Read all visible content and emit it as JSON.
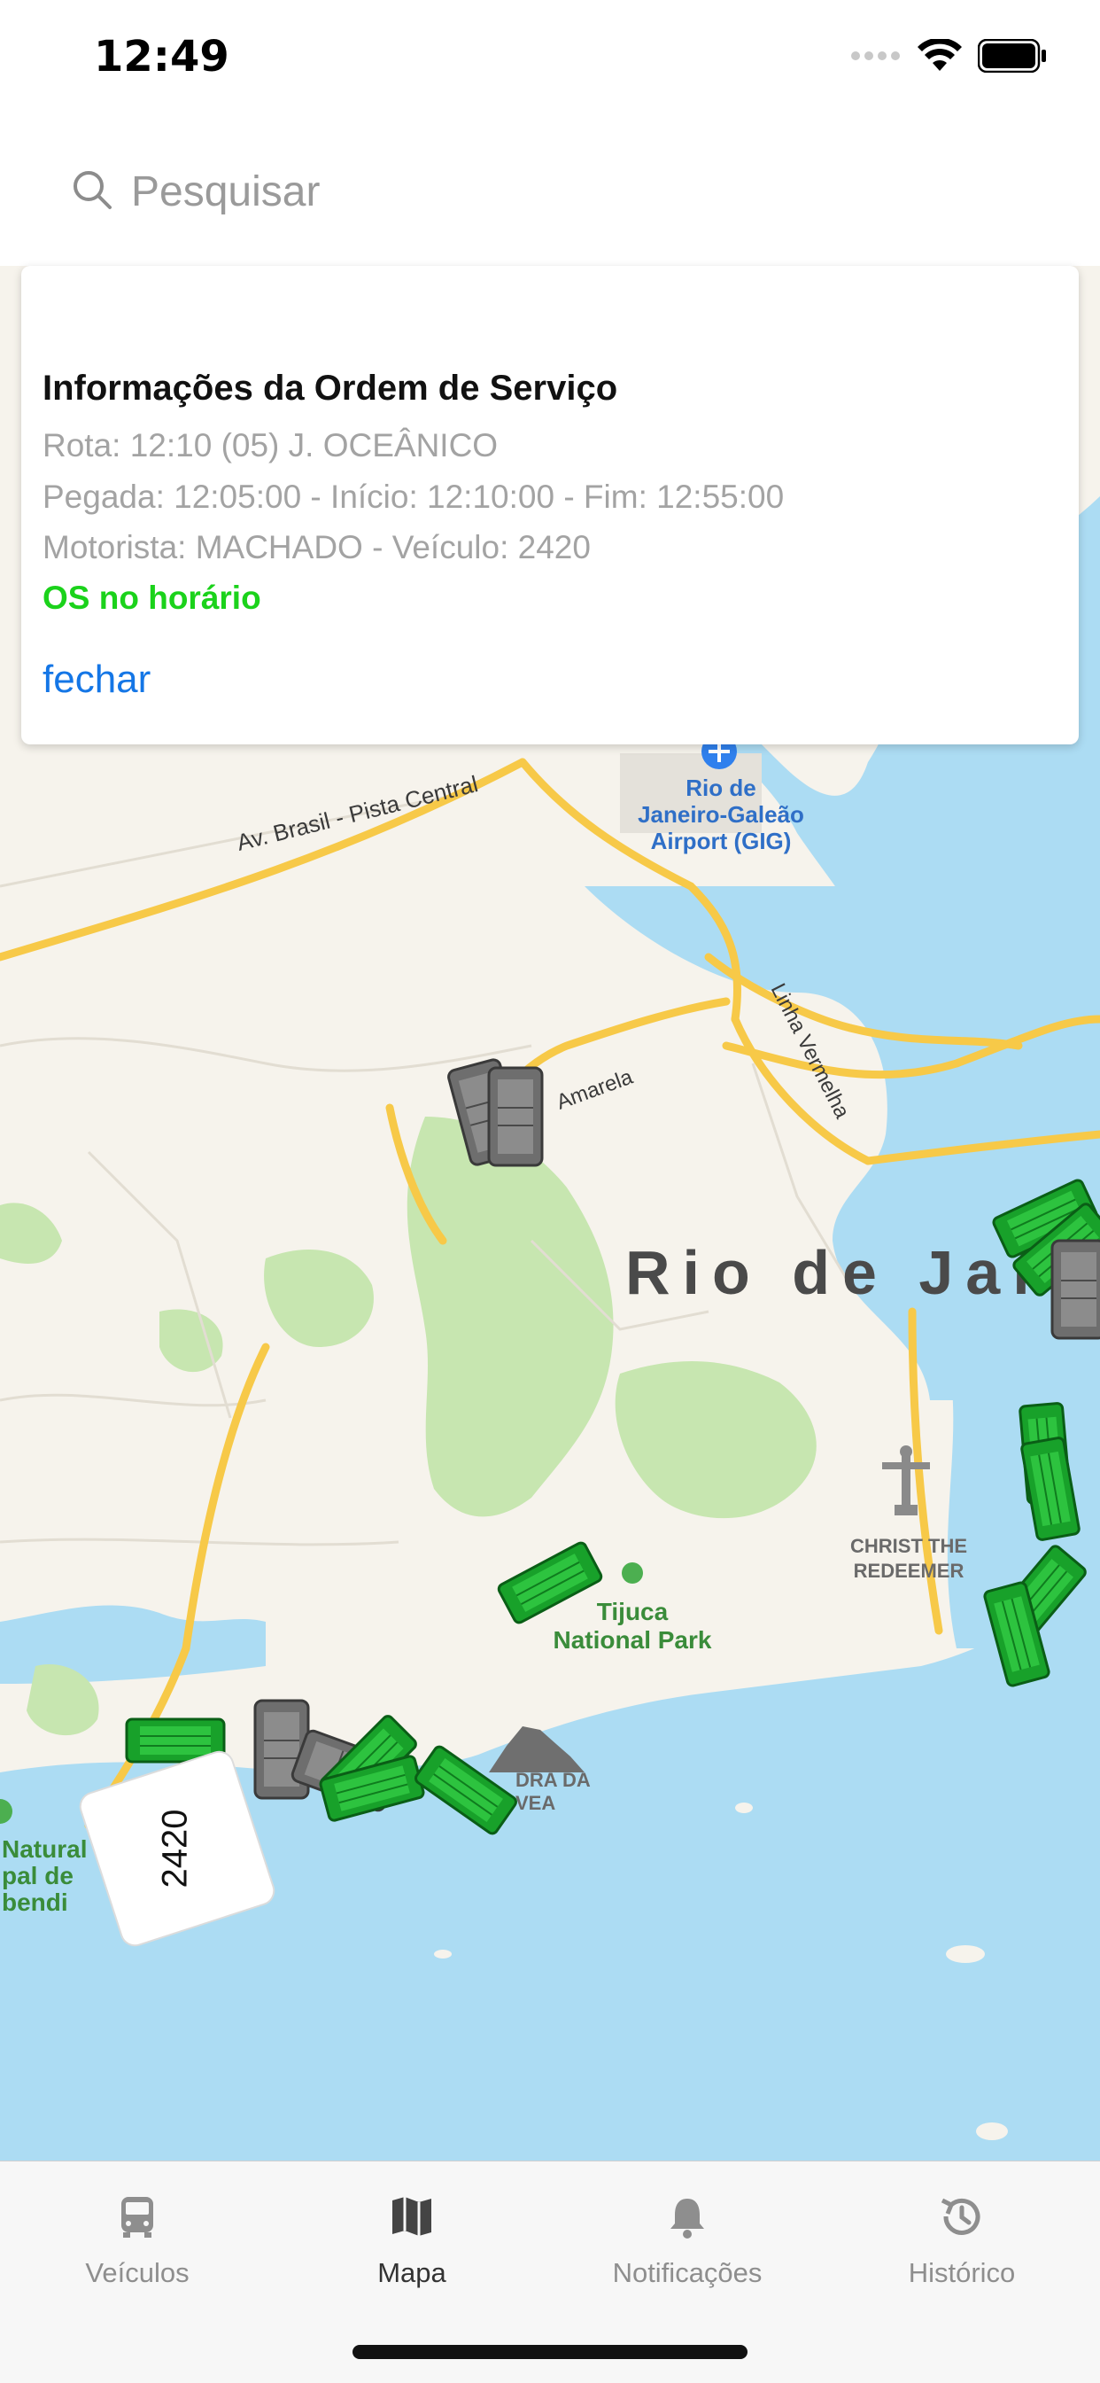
{
  "status_bar": {
    "time": "12:49"
  },
  "search": {
    "placeholder": "Pesquisar",
    "value": ""
  },
  "map": {
    "city_label": "Rio de Jai",
    "road_labels": [
      "Av. Brasil - Pista Central",
      "Linha Vermelha",
      "Amarela"
    ],
    "poi_labels": {
      "airport": [
        "Rio de",
        "Janeiro-Galeão",
        "Airport (GIG)"
      ],
      "park": [
        "Tijuca",
        "National Park"
      ],
      "christ": [
        "CHRIST THE",
        "REDEEMER"
      ],
      "pedra": [
        "DRA DA",
        "VEA"
      ],
      "parque": [
        "Natural",
        "pal de",
        "bendi"
      ]
    },
    "vehicle_tag": "2420",
    "colors": {
      "water": "#acdcf3",
      "land": "#f6f3ec",
      "green": "#c7e6b0",
      "road": "#f7c948",
      "bus_on_time": "#1a9e2a",
      "bus_other": "#6e6e6e"
    }
  },
  "info_card": {
    "title": "Informações da Ordem de Serviço",
    "route": "Rota: 12:10 (05) J. OCEÂNICO",
    "times": "Pegada: 12:05:00 - Início: 12:10:00 - Fim: 12:55:00",
    "driver_vehicle": "Motorista: MACHADO - Veículo: 2420",
    "status": "OS no horário",
    "close_label": "fechar",
    "status_color": "#1bd21b"
  },
  "tabbar": {
    "tabs": [
      {
        "label": "Veículos",
        "icon": "bus-icon",
        "active": false
      },
      {
        "label": "Mapa",
        "icon": "map-icon",
        "active": true
      },
      {
        "label": "Notificações",
        "icon": "bell-icon",
        "active": false
      },
      {
        "label": "Histórico",
        "icon": "history-icon",
        "active": false
      }
    ]
  }
}
